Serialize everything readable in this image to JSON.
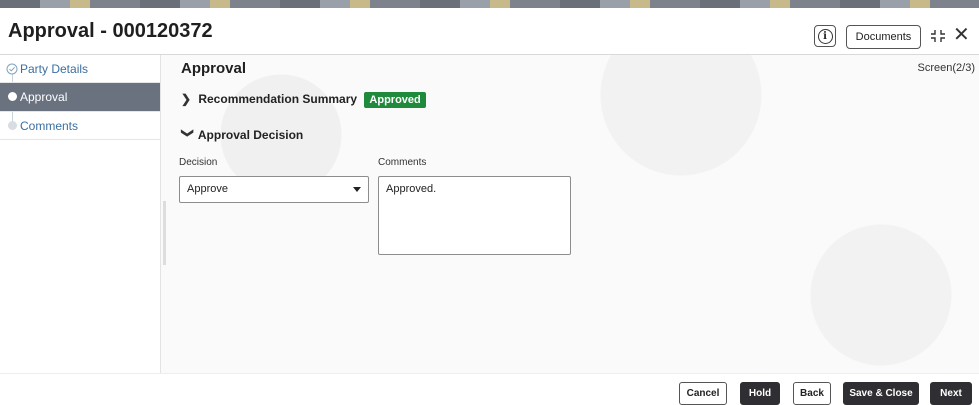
{
  "header": {
    "title": "Approval - 000120372",
    "info_glyph": "i",
    "documents_label": "Documents",
    "close_glyph": "✕"
  },
  "sidebar": {
    "items": [
      {
        "label": "Party Details",
        "state": "completed"
      },
      {
        "label": "Approval",
        "state": "active"
      },
      {
        "label": "Comments",
        "state": "pending"
      }
    ]
  },
  "main": {
    "title": "Approval",
    "screen_indicator": "Screen(2/3)",
    "recommendation": {
      "label": "Recommendation Summary",
      "badge": "Approved",
      "expanded": false
    },
    "decision_section": {
      "label": "Approval Decision",
      "expanded": true
    },
    "decision_field": {
      "label": "Decision",
      "value": "Approve"
    },
    "comments_field": {
      "label": "Comments",
      "value": "Approved."
    }
  },
  "footer": {
    "cancel_label": "Cancel",
    "hold_label": "Hold",
    "back_label": "Back",
    "save_close_label": "Save & Close",
    "next_label": "Next"
  },
  "colors": {
    "accent_dark": "#2f2f33",
    "sidebar_active": "#6a7280",
    "badge_green": "#1f8a3b"
  }
}
